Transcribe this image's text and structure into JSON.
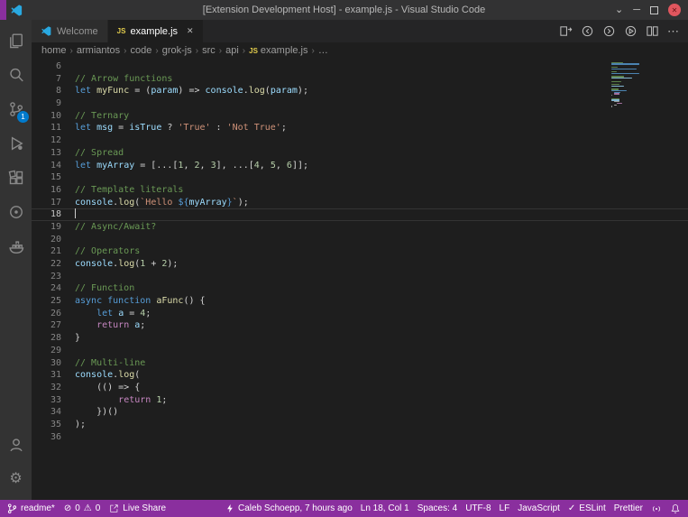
{
  "window": {
    "title": "[Extension Development Host] - example.js - Visual Studio Code"
  },
  "tabs": {
    "welcome": {
      "label": "Welcome"
    },
    "file": {
      "label": "example.js"
    }
  },
  "breadcrumb": [
    "home",
    "armiantos",
    "code",
    "grok-js",
    "src",
    "api",
    "example.js",
    "…"
  ],
  "editor": {
    "active_line": 18,
    "lines": [
      {
        "n": 6,
        "t": []
      },
      {
        "n": 7,
        "t": [
          [
            "cm",
            "// Arrow functions"
          ]
        ]
      },
      {
        "n": 8,
        "t": [
          [
            "kw",
            "let"
          ],
          [
            "pl",
            " "
          ],
          [
            "fn",
            "myFunc"
          ],
          [
            "pl",
            " = ("
          ],
          [
            "vr",
            "param"
          ],
          [
            "pl",
            ") => "
          ],
          [
            "vr",
            "console"
          ],
          [
            "pl",
            "."
          ],
          [
            "fn",
            "log"
          ],
          [
            "pl",
            "("
          ],
          [
            "vr",
            "param"
          ],
          [
            "pl",
            ");"
          ]
        ]
      },
      {
        "n": 9,
        "t": []
      },
      {
        "n": 10,
        "t": [
          [
            "cm",
            "// Ternary"
          ]
        ]
      },
      {
        "n": 11,
        "t": [
          [
            "kw",
            "let"
          ],
          [
            "pl",
            " "
          ],
          [
            "vr",
            "msg"
          ],
          [
            "pl",
            " = "
          ],
          [
            "vr",
            "isTrue"
          ],
          [
            "pl",
            " ? "
          ],
          [
            "st",
            "'True'"
          ],
          [
            "pl",
            " : "
          ],
          [
            "st",
            "'Not True'"
          ],
          [
            "pl",
            ";"
          ]
        ]
      },
      {
        "n": 12,
        "t": []
      },
      {
        "n": 13,
        "t": [
          [
            "cm",
            "// Spread"
          ]
        ]
      },
      {
        "n": 14,
        "t": [
          [
            "kw",
            "let"
          ],
          [
            "pl",
            " "
          ],
          [
            "vr",
            "myArray"
          ],
          [
            "pl",
            " = [...["
          ],
          [
            "nm",
            "1"
          ],
          [
            "pl",
            ", "
          ],
          [
            "nm",
            "2"
          ],
          [
            "pl",
            ", "
          ],
          [
            "nm",
            "3"
          ],
          [
            "pl",
            "], ...["
          ],
          [
            "nm",
            "4"
          ],
          [
            "pl",
            ", "
          ],
          [
            "nm",
            "5"
          ],
          [
            "pl",
            ", "
          ],
          [
            "nm",
            "6"
          ],
          [
            "pl",
            "]];"
          ]
        ]
      },
      {
        "n": 15,
        "t": []
      },
      {
        "n": 16,
        "t": [
          [
            "cm",
            "// Template literals"
          ]
        ]
      },
      {
        "n": 17,
        "t": [
          [
            "vr",
            "console"
          ],
          [
            "pl",
            "."
          ],
          [
            "fn",
            "log"
          ],
          [
            "pl",
            "("
          ],
          [
            "st",
            "`Hello "
          ],
          [
            "tp",
            "${"
          ],
          [
            "vr",
            "myArray"
          ],
          [
            "tp",
            "}"
          ],
          [
            "st",
            "`"
          ],
          [
            "pl",
            ");"
          ]
        ]
      },
      {
        "n": 18,
        "t": []
      },
      {
        "n": 19,
        "t": [
          [
            "cm",
            "// Async/Await?"
          ]
        ]
      },
      {
        "n": 20,
        "t": []
      },
      {
        "n": 21,
        "t": [
          [
            "cm",
            "// Operators"
          ]
        ]
      },
      {
        "n": 22,
        "t": [
          [
            "vr",
            "console"
          ],
          [
            "pl",
            "."
          ],
          [
            "fn",
            "log"
          ],
          [
            "pl",
            "("
          ],
          [
            "nm",
            "1"
          ],
          [
            "pl",
            " + "
          ],
          [
            "nm",
            "2"
          ],
          [
            "pl",
            ");"
          ]
        ]
      },
      {
        "n": 23,
        "t": []
      },
      {
        "n": 24,
        "t": [
          [
            "cm",
            "// Function"
          ]
        ]
      },
      {
        "n": 25,
        "t": [
          [
            "kw",
            "async"
          ],
          [
            "pl",
            " "
          ],
          [
            "kw",
            "function"
          ],
          [
            "pl",
            " "
          ],
          [
            "fn",
            "aFunc"
          ],
          [
            "pl",
            "() {"
          ]
        ]
      },
      {
        "n": 26,
        "t": [
          [
            "pl",
            "    "
          ],
          [
            "kw",
            "let"
          ],
          [
            "pl",
            " "
          ],
          [
            "vr",
            "a"
          ],
          [
            "pl",
            " = "
          ],
          [
            "nm",
            "4"
          ],
          [
            "pl",
            ";"
          ]
        ]
      },
      {
        "n": 27,
        "t": [
          [
            "pl",
            "    "
          ],
          [
            "ct",
            "return"
          ],
          [
            "pl",
            " "
          ],
          [
            "vr",
            "a"
          ],
          [
            "pl",
            ";"
          ]
        ]
      },
      {
        "n": 28,
        "t": [
          [
            "pl",
            "}"
          ]
        ]
      },
      {
        "n": 29,
        "t": []
      },
      {
        "n": 30,
        "t": [
          [
            "cm",
            "// Multi-line"
          ]
        ]
      },
      {
        "n": 31,
        "t": [
          [
            "vr",
            "console"
          ],
          [
            "pl",
            "."
          ],
          [
            "fn",
            "log"
          ],
          [
            "pl",
            "("
          ]
        ]
      },
      {
        "n": 32,
        "t": [
          [
            "pl",
            "    (() => {"
          ]
        ]
      },
      {
        "n": 33,
        "t": [
          [
            "pl",
            "        "
          ],
          [
            "ct",
            "return"
          ],
          [
            "pl",
            " "
          ],
          [
            "nm",
            "1"
          ],
          [
            "pl",
            ";"
          ]
        ]
      },
      {
        "n": 34,
        "t": [
          [
            "pl",
            "    })()"
          ]
        ]
      },
      {
        "n": 35,
        "t": [
          [
            "pl",
            ");"
          ]
        ]
      },
      {
        "n": 36,
        "t": []
      }
    ]
  },
  "status_bar": {
    "branch": "readme*",
    "errors": "0",
    "warnings": "0",
    "live_share": "Live Share",
    "blame": "Caleb Schoepp, 7 hours ago",
    "cursor": "Ln 18, Col 1",
    "indent": "Spaces: 4",
    "encoding": "UTF-8",
    "eol": "LF",
    "language": "JavaScript",
    "eslint": "ESLint",
    "prettier": "Prettier"
  },
  "icons": {
    "separator": "›",
    "check": "✓",
    "more": "⋯",
    "error": "⊘",
    "warning": "⚠",
    "chevron_down": "⌄",
    "minimize": "─",
    "close": "✕",
    "gear": "⚙",
    "js_badge": "JS"
  },
  "colors": {
    "status_bar": "#8a2f9e",
    "activity_badge": "#007acc",
    "close_button": "#e0565e",
    "js_icon": "#e3cd4d"
  },
  "token_colors": {
    "cm": "#6A9955",
    "kw": "#569CD6",
    "ct": "#C586C0",
    "vr": "#9CDCFE",
    "fn": "#DCDCAA",
    "st": "#CE9178",
    "nm": "#B5CEA8",
    "pl": "#bdbdbd",
    "tp": "#569CD6"
  }
}
